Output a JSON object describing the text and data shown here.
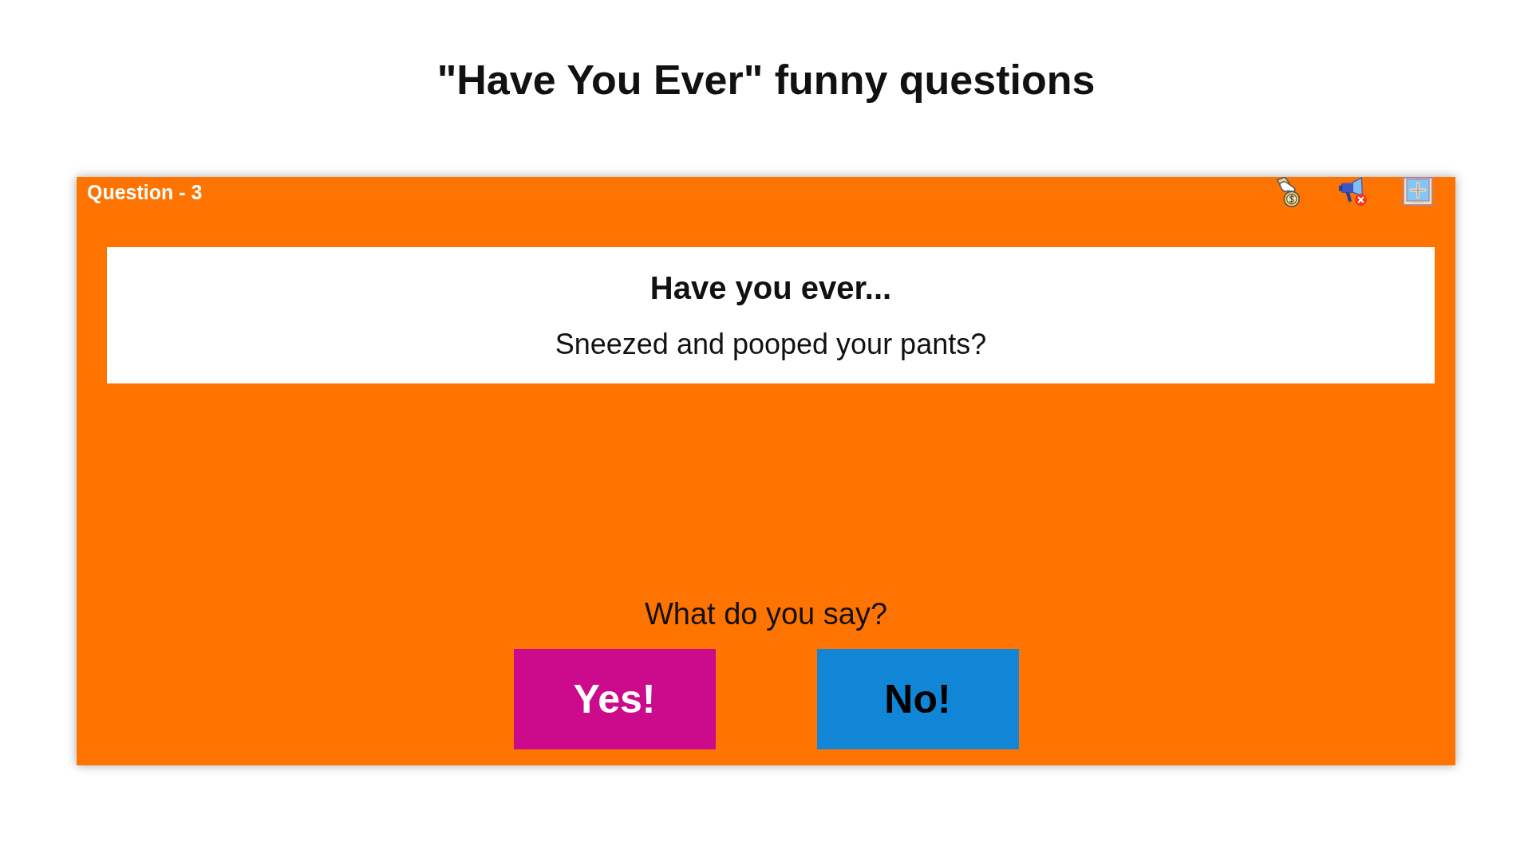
{
  "page": {
    "title": "\"Have You Ever\" funny questions"
  },
  "question_panel": {
    "label": "Question - 3",
    "card": {
      "heading": "Have you ever...",
      "question": "Sneezed and pooped your pants?"
    },
    "prompt": "What do you say?",
    "answers": [
      {
        "label": "Yes!",
        "color": "#cc0a8c"
      },
      {
        "label": "No!",
        "color": "#1286d6"
      }
    ]
  }
}
